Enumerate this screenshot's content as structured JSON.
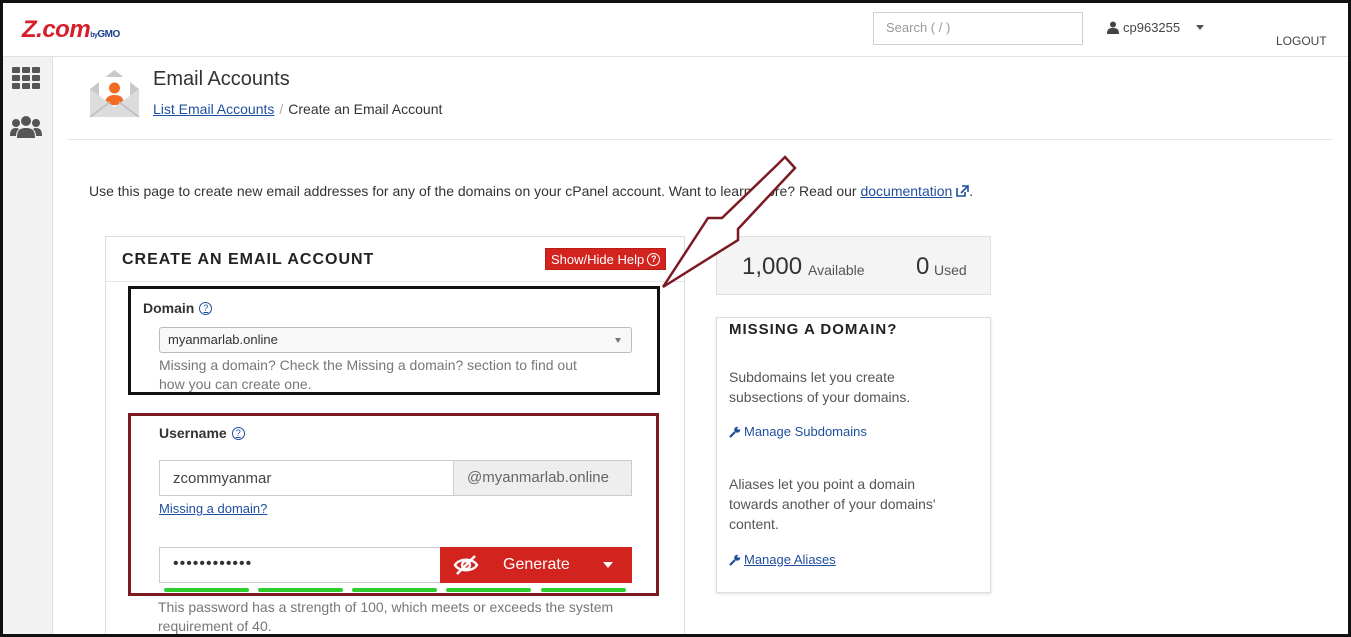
{
  "header": {
    "logo_main": "Z.com",
    "logo_by": "by",
    "logo_gmo": "GMO",
    "search_placeholder": "Search ( / )",
    "username": "cp963255",
    "logout": "LOGOUT"
  },
  "page": {
    "title": "Email Accounts",
    "breadcrumb_link": "List Email Accounts",
    "breadcrumb_sep": "/",
    "breadcrumb_current": "Create an Email Account",
    "intro_text": "Use this page to create new email addresses for any of the domains on your cPanel account. Want to learn more? Read our",
    "intro_link": "documentation",
    "intro_end": "."
  },
  "form": {
    "panel_title": "CREATE AN EMAIL ACCOUNT",
    "help_button": "Show/Hide Help",
    "help_q": "?",
    "domain_label": "Domain",
    "domain_value": "myanmarlab.online",
    "domain_help_1": "Missing a domain? Check the Missing a domain? section to find out",
    "domain_help_2": "how you can create one.",
    "username_label": "Username",
    "username_value": "zcommyanmar",
    "username_suffix": "@myanmarlab.online",
    "missing_domain_link": "Missing a domain?",
    "password_value": "••••••••••••",
    "generate_label": "Generate",
    "strength_text_1": "This password has a strength of 100, which meets or exceeds the system",
    "strength_text_2": "requirement of 40.",
    "strength_fraction": 1.0
  },
  "stats": {
    "available_count": "1,000",
    "available_label": "Available",
    "used_count": "0",
    "used_label": "Used"
  },
  "missing_panel": {
    "title": "MISSING A DOMAIN?",
    "text1_1": "Subdomains let you create",
    "text1_2": "subsections of your domains.",
    "link1": "Manage Subdomains",
    "text2_1": "Aliases let you point a domain",
    "text2_2": "towards another of your domains'",
    "text2_3": "content.",
    "link2": "Manage Aliases"
  },
  "colors": {
    "brand_red": "#d3231f",
    "link_blue": "#1f4e9f",
    "strength_green": "#2ecc2e",
    "annotation_red": "#7b1a22"
  }
}
